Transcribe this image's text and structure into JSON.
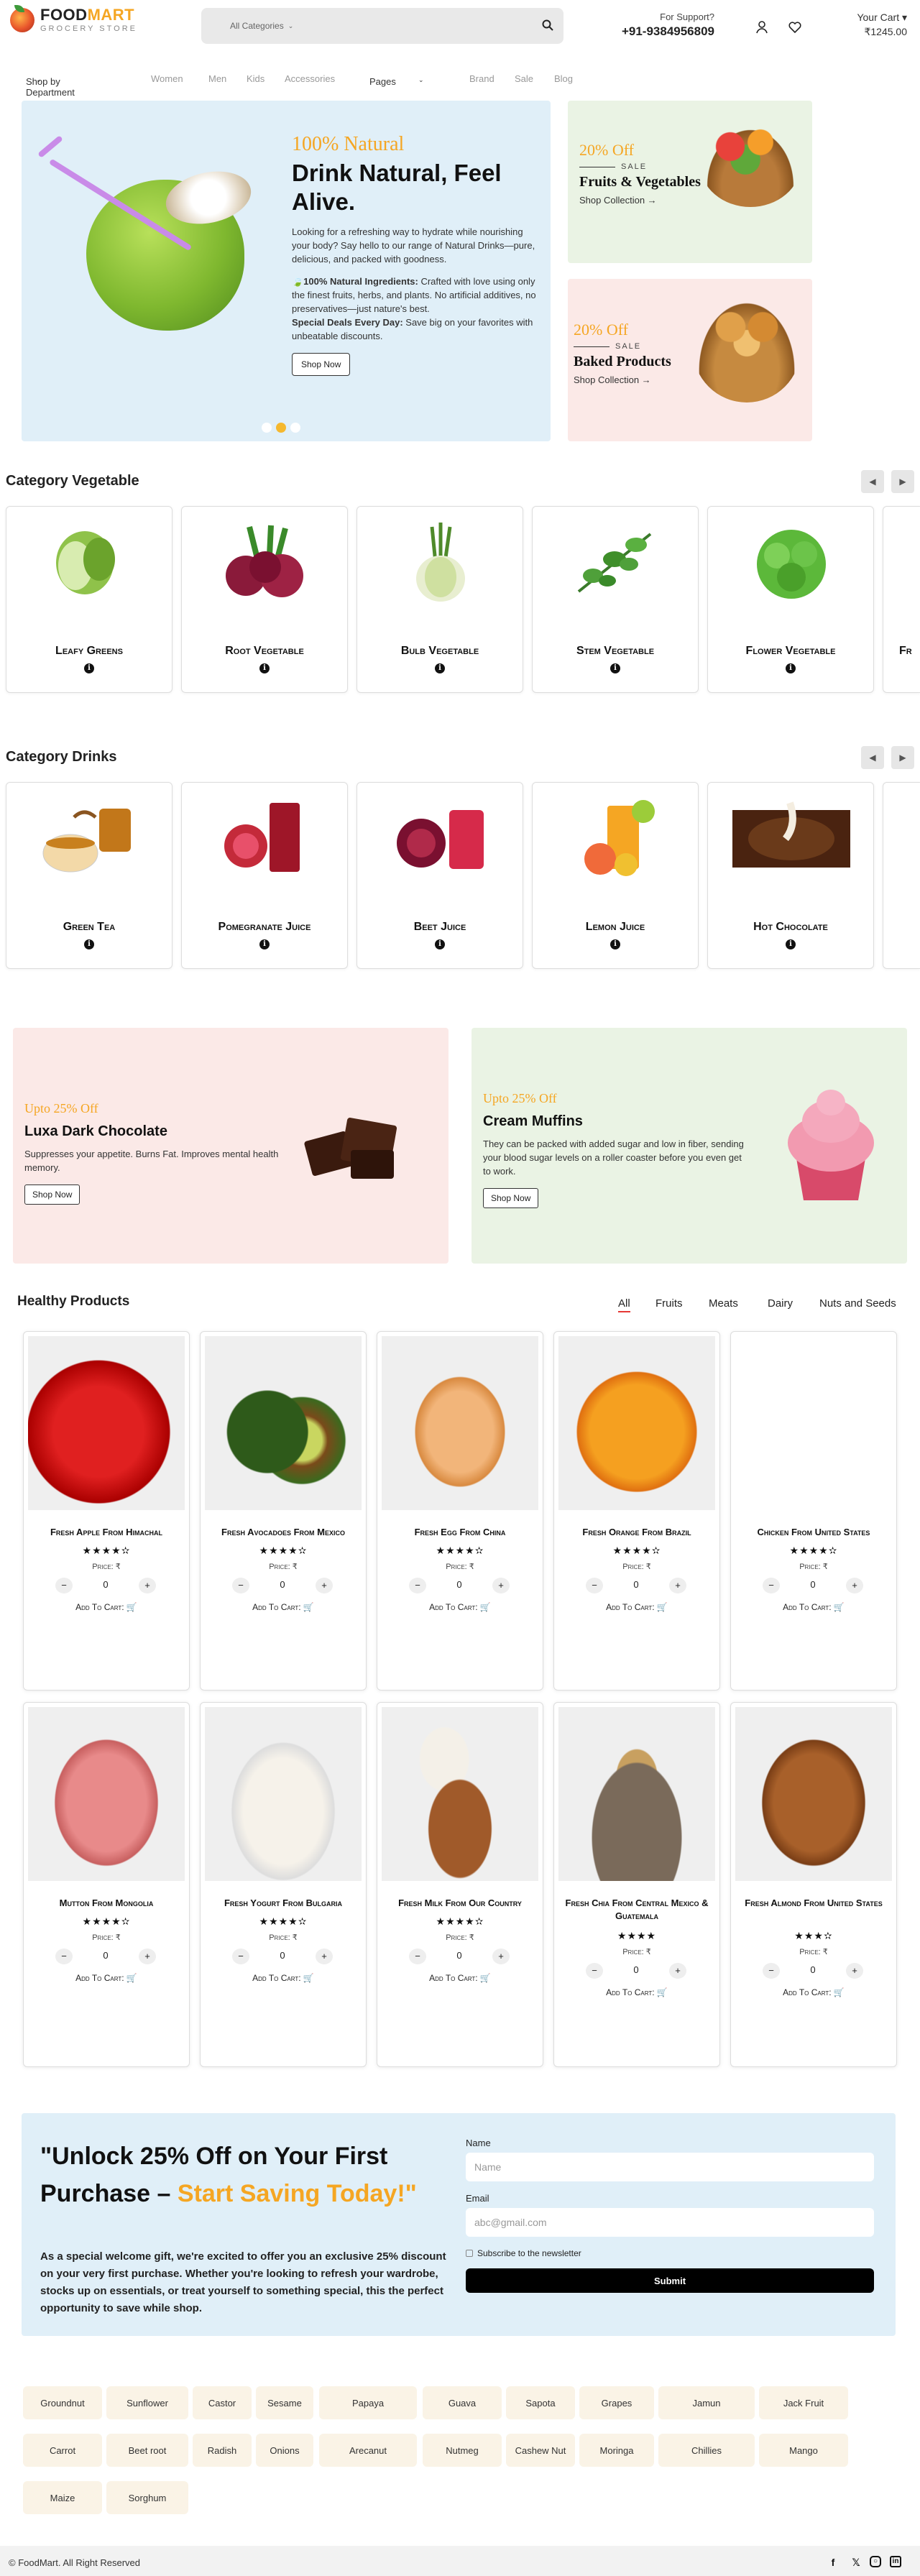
{
  "header": {
    "logo_part1": "FOOD",
    "logo_part2": "MART",
    "logo_sub": "GROCERY STORE",
    "category_select": "All Categories",
    "support_label": "For Support?",
    "support_phone": "+91-9384956809",
    "cart_label": "Your Cart ▾",
    "cart_amount": "₹1245.00"
  },
  "nav": {
    "department": "Shop by Department",
    "links": [
      "Women",
      "Men",
      "Kids",
      "Accessories"
    ],
    "pages": "Pages",
    "links2": [
      "Brand",
      "Sale",
      "Blog"
    ]
  },
  "hero": {
    "eyebrow": "100% Natural",
    "title": "Drink Natural, Feel Alive.",
    "desc": "Looking for a refreshing way to hydrate while nourishing your body? Say hello to our range of Natural Drinks—pure, delicious, and packed with goodness.",
    "point1_title": "🍃100% Natural Ingredients:",
    "point1_text": "Crafted with love using only the finest fruits, herbs, and plants. No artificial additives, no preservatives—just nature's best.",
    "point2_title": "Special Deals Every Day:",
    "point2_text": "Save big on your favorites with unbeatable discounts.",
    "button": "Shop Now"
  },
  "promos": [
    {
      "off": "20% Off",
      "sale": "SALE",
      "title": "Fruits & Vegetables",
      "link": "Shop Collection →",
      "bg": "#eaf3e4"
    },
    {
      "off": "20% Off",
      "sale": "SALE",
      "title": "Baked Products",
      "link": "Shop Collection →",
      "bg": "#fbe9e7"
    }
  ],
  "veg_section": {
    "title": "Category Vegetable",
    "items": [
      "Leafy Greens",
      "Root Vegetable",
      "Bulb Vegetable",
      "Stem Vegetable",
      "Flower Vegetable",
      "Fr"
    ]
  },
  "drinks_section": {
    "title": "Category Drinks",
    "items": [
      "Green Tea",
      "Pomegranate Juice",
      "Beet Juice",
      "Lemon Juice",
      "Hot Chocolate"
    ]
  },
  "banners": [
    {
      "off": "Upto 25% Off",
      "title": "Luxa Dark Chocolate",
      "desc": "Suppresses your appetite. Burns Fat. Improves mental health memory.",
      "button": "Shop Now",
      "bg": "#fbe9e7"
    },
    {
      "off": "Upto 25% Off",
      "title": "Cream Muffins",
      "desc": "They can be packed with added sugar and low in fiber, sending your blood sugar levels on a roller coaster before you even get to work.",
      "button": "Shop Now",
      "bg": "#eaf3e4"
    }
  ],
  "products": {
    "title": "Healthy Products",
    "tabs": [
      "All",
      "Fruits",
      "Meats",
      "Dairy",
      "Nuts and Seeds"
    ],
    "price_label": "Price: ₹",
    "add_to_cart": "Add To Cart:",
    "qty_value": "0",
    "items": [
      {
        "name": "Fresh Apple From Himachal",
        "stars": "★★★★✫"
      },
      {
        "name": "Fresh Avocadoes From Mexico",
        "stars": "★★★★✫"
      },
      {
        "name": "Fresh Egg From China",
        "stars": "★★★★✫"
      },
      {
        "name": "Fresh Orange From Brazil",
        "stars": "★★★★✫"
      },
      {
        "name": "Chicken From United States",
        "stars": "★★★★✫"
      },
      {
        "name": "Mutton From Mongolia",
        "stars": "★★★★✫"
      },
      {
        "name": "Fresh Yogurt From Bulgaria",
        "stars": "★★★★✫"
      },
      {
        "name": "Fresh Milk From Our Country",
        "stars": "★★★★✫"
      },
      {
        "name": "Fresh Chia From Central Mexico & Guatemala",
        "stars": "★★★★"
      },
      {
        "name": "Fresh Almond From United States",
        "stars": "★★★✫"
      }
    ]
  },
  "newsletter": {
    "title_part1": "\"Unlock 25% Off on Your First Purchase – ",
    "title_part2": "Start Saving Today!\"",
    "desc": "As a special welcome gift, we're excited to offer you an exclusive 25% discount on your very first purchase. Whether you're looking to refresh your wardrobe, stocks up on essentials, or treat yourself to something special, this the perfect opportunity to save while shop.",
    "name_label": "Name",
    "name_placeholder": "Name",
    "email_label": "Email",
    "email_placeholder": "abc@gmail.com",
    "checkbox": "Subscribe to the newsletter",
    "submit": "Submit"
  },
  "tags": [
    "Groundnut",
    "Sunflower",
    "Castor",
    "Sesame",
    "Papaya",
    "Guava",
    "Sapota",
    "Grapes",
    "Jamun",
    "Jack Fruit",
    "Carrot",
    "Beet root",
    "Radish",
    "Onions",
    "Arecanut",
    "Nutmeg",
    "Cashew Nut",
    "Moringa",
    "Chillies",
    "Mango",
    "Maize",
    "Sorghum"
  ],
  "footer": {
    "copyright": "© FoodMart. All Right Reserved",
    "social_icons": [
      "facebook-icon",
      "x-icon",
      "instagram-icon",
      "linkedin-icon"
    ]
  }
}
